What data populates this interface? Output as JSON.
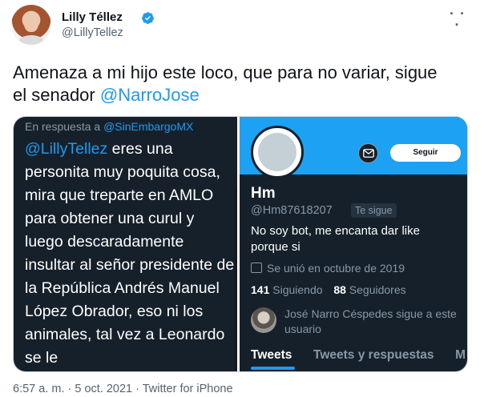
{
  "author": {
    "name": "Lilly Téllez",
    "handle": "@LillyTellez",
    "verified": true
  },
  "tweet": {
    "text_line1": "Amenaza a mi hijo este loco, que para no variar, sigue",
    "text_line2_prefix": "el senador ",
    "text_mention": "@NarroJose"
  },
  "left_screenshot": {
    "reply_prefix": "En respuesta a ",
    "reply_mention": "@SinEmbargoMX",
    "mention": "@LillyTellez",
    "body": " eres una personita muy poquita cosa, mira que treparte en AMLO para obtener una curul y luego descaradamente insultar al señor presidente de la República Andrés Manuel López Obrador, eso ni los animales, tal vez  a Leonardo se le"
  },
  "right_screenshot": {
    "follow_button": "Seguir",
    "profile_name": "Hm",
    "profile_handle": "@Hm87618207",
    "follows_you": "Te sigue",
    "bio": "No soy bot, me encanta dar like porque si",
    "joined": "Se unió en octubre de 2019",
    "following_count": "141",
    "following_label": "Siguiendo",
    "followers_count": "88",
    "followers_label": "Seguidores",
    "followed_by": "José Narro Céspedes sigue a este usuario",
    "tabs": [
      "Tweets",
      "Tweets y respuestas",
      "M"
    ]
  },
  "footer": {
    "timestamp": "6:57 a. m. · 5 oct. 2021 · Twitter for iPhone"
  },
  "colors": {
    "accent": "#1d9bf0",
    "dark_bg": "#15202b",
    "muted": "#536471"
  },
  "icons": [
    "verified-badge-icon",
    "more-options-icon",
    "message-icon",
    "calendar-icon"
  ]
}
